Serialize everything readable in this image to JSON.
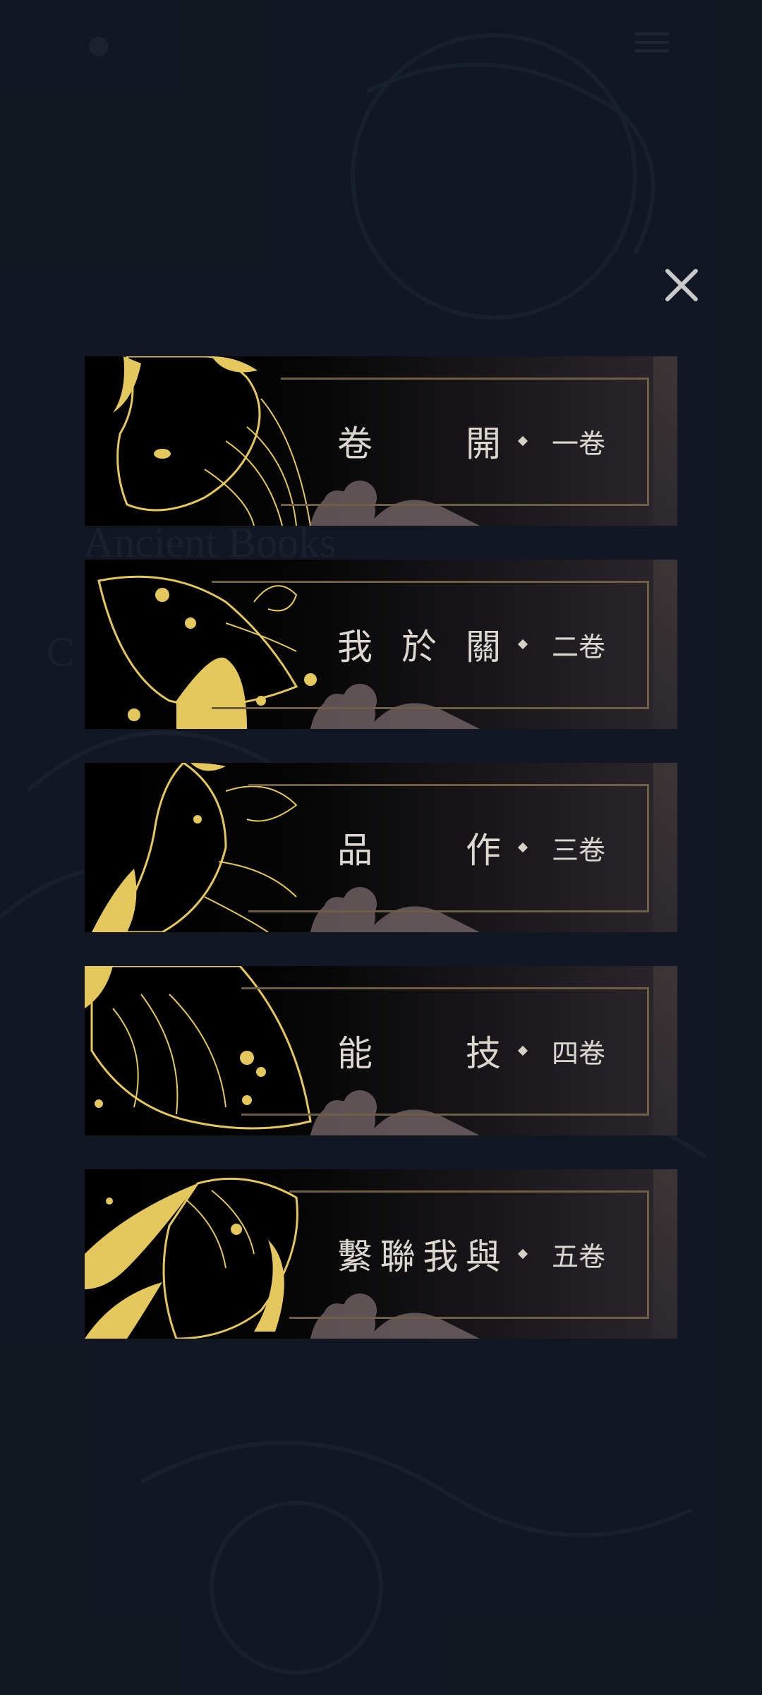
{
  "background": {
    "title": "Ancient Books",
    "subtitle": "C"
  },
  "topbar": {
    "logo_icon": "logo-icon",
    "menu_icon": "hamburger-menu-icon"
  },
  "overlay": {
    "close_icon": "close-icon"
  },
  "menu": {
    "items": [
      {
        "chars": [
          "卷",
          "開"
        ],
        "volume": "一卷",
        "creature": "goat"
      },
      {
        "chars": [
          "我",
          "於",
          "關"
        ],
        "volume": "二卷",
        "creature": "fish"
      },
      {
        "chars": [
          "品",
          "作"
        ],
        "volume": "三卷",
        "creature": "dragon"
      },
      {
        "chars": [
          "能",
          "技"
        ],
        "volume": "四卷",
        "creature": "serpent"
      },
      {
        "chars": [
          "繫",
          "聯",
          "我",
          "與"
        ],
        "volume": "五卷",
        "creature": "horse"
      }
    ]
  },
  "colors": {
    "background": "#141a24",
    "gold": "#e4c75d",
    "label": "#ddd7d0"
  }
}
